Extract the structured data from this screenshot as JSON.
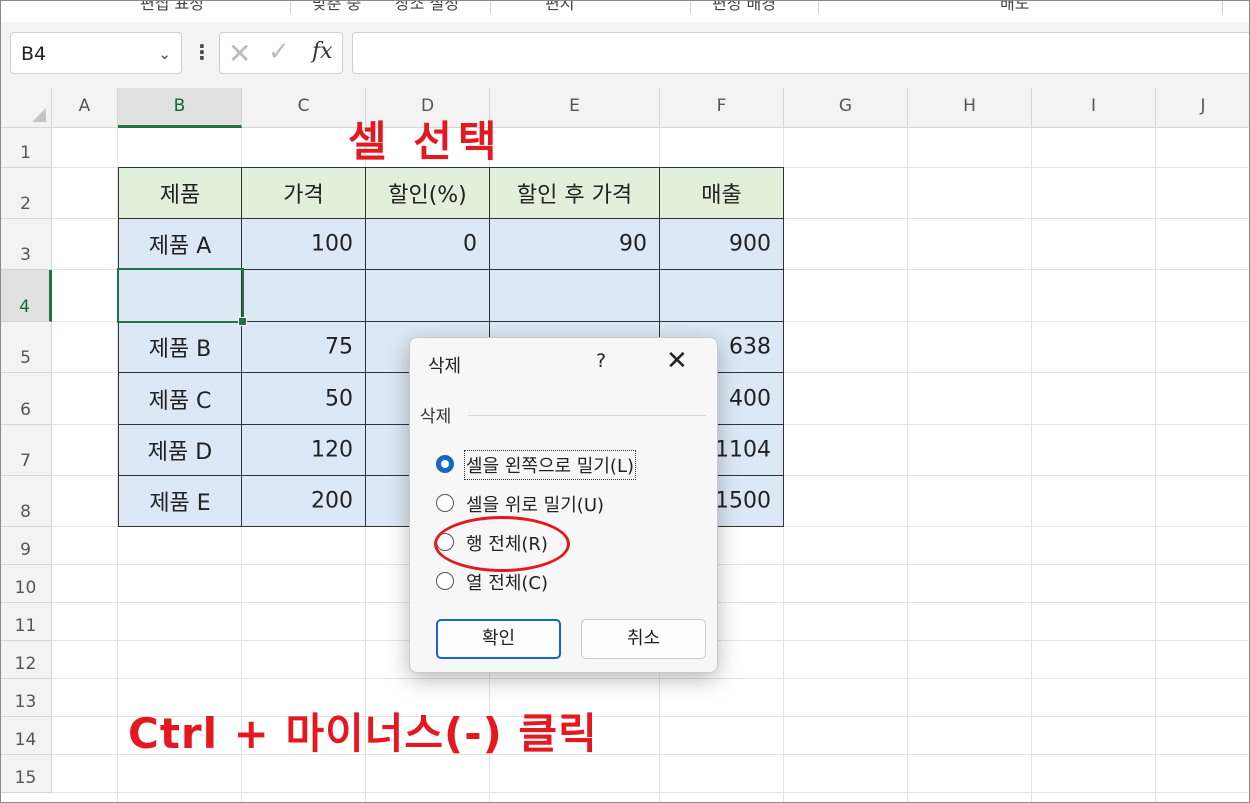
{
  "ribbon": {
    "labels": [
      "편집 표정",
      "맞춘 중",
      "장소 설정",
      "편지",
      "편성 배경",
      "배도"
    ]
  },
  "formula_bar": {
    "name_box": "B4",
    "name_dropdown_icon": "chevron-down-icon",
    "cancel_icon": "✕",
    "enter_icon": "✓",
    "function_icon": "fx",
    "formula": ""
  },
  "columns": [
    "A",
    "B",
    "C",
    "D",
    "E",
    "F",
    "G",
    "H",
    "I",
    "J"
  ],
  "rows": [
    "1",
    "2",
    "3",
    "4",
    "5",
    "6",
    "7",
    "8",
    "9",
    "10",
    "11",
    "12",
    "13",
    "14",
    "15"
  ],
  "selected_cell": "B4",
  "table": {
    "headers": [
      "제품",
      "가격",
      "할인(%)",
      "할인 후 가격",
      "매출"
    ],
    "rows": [
      [
        "제품 A",
        "100",
        "0",
        "90",
        "900"
      ],
      [
        "",
        "",
        "",
        "",
        ""
      ],
      [
        "제품 B",
        "75",
        "",
        "",
        "638"
      ],
      [
        "제품 C",
        "50",
        "",
        "",
        "400"
      ],
      [
        "제품 D",
        "120",
        "",
        "",
        "1104"
      ],
      [
        "제품 E",
        "200",
        "",
        "",
        "1500"
      ]
    ]
  },
  "annotations": {
    "title": "셀 선택",
    "instruction": "Ctrl + 마이너스(-) 클릭",
    "highlight_color": "#e5181f"
  },
  "dialog": {
    "title": "삭제",
    "help": "?",
    "close": "✕",
    "group_label": "삭제",
    "options": [
      {
        "label": "셀을 왼쪽으로 밀기(L)",
        "selected": true
      },
      {
        "label": "셀을 위로 밀기(U)",
        "selected": false
      },
      {
        "label": "행 전체(R)",
        "selected": false
      },
      {
        "label": "열 전체(C)",
        "selected": false
      }
    ],
    "ok_label": "확인",
    "cancel_label": "취소"
  },
  "colors": {
    "accent": "#217346",
    "header_fill": "#e2efda",
    "body_fill": "#dce8f5",
    "radio": "#1766c8"
  }
}
